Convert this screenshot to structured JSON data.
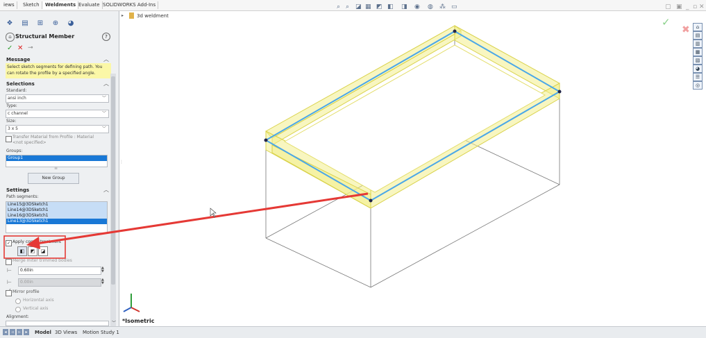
{
  "menu_tabs": [
    "iews",
    "Sketch",
    "Weldments",
    "Evaluate",
    "SOLIDWORKS Add-Ins"
  ],
  "feature_manager_icons": [
    "feature-tree-icon",
    "property-manager-icon",
    "configuration-icon",
    "dimxpert-icon",
    "appearance-icon"
  ],
  "pm": {
    "title": "Structural Member",
    "help": "?",
    "ok": "✓",
    "cancel": "✕",
    "pin": "⊸"
  },
  "message": {
    "title": "Message",
    "text": "Select sketch segments for defining path. You can rotate the profile by a specified angle."
  },
  "selections": {
    "title": "Selections",
    "standard_label": "Standard:",
    "standard_value": "ansi inch",
    "type_label": "Type:",
    "type_value": "c channel",
    "size_label": "Size:",
    "size_value": "3 x 5",
    "transfer_label": "Transfer Material from Profile : Material <not specified>",
    "groups_label": "Groups:",
    "groups": [
      "Group1"
    ],
    "new_group": "New Group"
  },
  "settings": {
    "title": "Settings",
    "path_label": "Path segments:",
    "path_segments": [
      "Line15@3DSketch1",
      "Line14@3DSketch1",
      "Line16@3DSketch1",
      "Line13@3DSketch1"
    ],
    "apply_corner": "Apply corner treatment",
    "merge_label": "Merge miter trimmed bodies",
    "gap1": "0.60in",
    "gap2": "0.00in",
    "mirror_label": "Mirror profile",
    "horizontal_axis": "Horizontal axis",
    "vertical_axis": "Vertical axis",
    "alignment_label": "Alignment:"
  },
  "breadcrumb": "3d weldment",
  "view_name": "*Isometric",
  "bottom_tabs": [
    "Model",
    "3D Views",
    "Motion Study 1"
  ],
  "colors": {
    "highlight_yellow": "#f2ef8c",
    "path_blue": "#4aa7e8",
    "arrow_red": "#e53935",
    "selection_blue": "#1978d6"
  }
}
